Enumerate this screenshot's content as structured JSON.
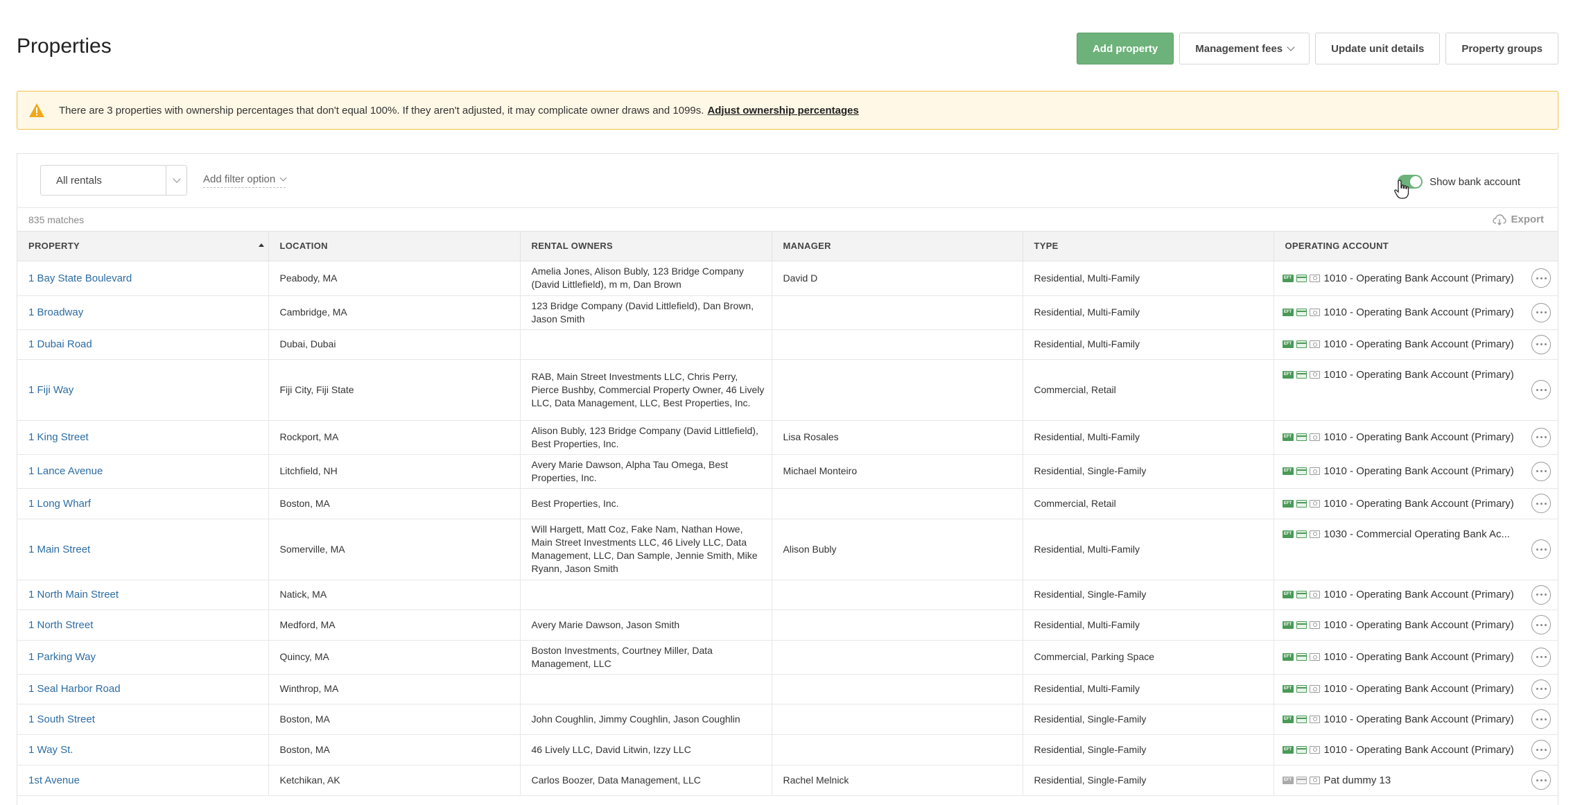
{
  "page": {
    "title": "Properties"
  },
  "toolbar": {
    "add_property": "Add property",
    "management_fees": "Management fees",
    "update_unit_details": "Update unit details",
    "property_groups": "Property groups"
  },
  "warning": {
    "message": "There are 3 properties with ownership percentages that don't equal 100%. If they aren't adjusted, it may complicate owner draws and 1099s.",
    "link": "Adjust ownership percentages"
  },
  "filters": {
    "rentals_select": "All rentals",
    "add_filter": "Add filter option",
    "show_bank_account": "Show bank account",
    "show_bank_account_on": true
  },
  "results": {
    "matches": "835 matches",
    "export": "Export"
  },
  "table": {
    "columns": [
      "PROPERTY",
      "LOCATION",
      "RENTAL OWNERS",
      "MANAGER",
      "TYPE",
      "OPERATING ACCOUNT"
    ],
    "rows": [
      {
        "property": "1 Bay State Boulevard",
        "location": "Peabody, MA",
        "owners": "Amelia Jones, Alison Bubly, 123 Bridge Company (David Littlefield), m m, Dan Brown",
        "manager": "David D",
        "type": "Residential, Multi-Family",
        "account": "1010 - Operating Bank Account (Primary)"
      },
      {
        "property": "1 Broadway",
        "location": "Cambridge, MA",
        "owners": "123 Bridge Company (David Littlefield), Dan Brown, Jason Smith",
        "manager": "",
        "type": "Residential, Multi-Family",
        "account": "1010 - Operating Bank Account (Primary)"
      },
      {
        "property": "1 Dubai Road",
        "location": "Dubai, Dubai",
        "owners": "",
        "manager": "",
        "type": "Residential, Multi-Family",
        "account": "1010 - Operating Bank Account (Primary)"
      },
      {
        "property": "1 Fiji Way",
        "location": "Fiji City, Fiji State",
        "owners": "RAB, Main Street Investments LLC, Chris Perry, Pierce Bushby, Commercial Property Owner, 46 Lively LLC, Data Management, LLC, Best Properties, Inc.",
        "manager": "",
        "type": "Commercial, Retail",
        "account": "1010 - Operating Bank Account (Primary)"
      },
      {
        "property": "1 King Street",
        "location": "Rockport, MA",
        "owners": "Alison Bubly, 123 Bridge Company (David Littlefield), Best Properties, Inc.",
        "manager": "Lisa Rosales",
        "type": "Residential, Multi-Family",
        "account": "1010 - Operating Bank Account (Primary)"
      },
      {
        "property": "1 Lance Avenue",
        "location": "Litchfield, NH",
        "owners": "Avery Marie Dawson, Alpha Tau Omega, Best Properties, Inc.",
        "manager": "Michael Monteiro",
        "type": "Residential, Single-Family",
        "account": "1010 - Operating Bank Account (Primary)"
      },
      {
        "property": "1 Long Wharf",
        "location": "Boston, MA",
        "owners": "Best Properties, Inc.",
        "manager": "",
        "type": "Commercial, Retail",
        "account": "1010 - Operating Bank Account (Primary)"
      },
      {
        "property": "1 Main Street",
        "location": "Somerville, MA",
        "owners": "Will Hargett, Matt Coz, Fake Nam, Nathan Howe, Main Street Investments LLC, 46 Lively LLC, Data Management, LLC, Dan Sample, Jennie Smith, Mike Ryann, Jason Smith",
        "manager": "Alison Bubly",
        "type": "Residential, Multi-Family",
        "account": "1030 - Commercial Operating Bank Ac..."
      },
      {
        "property": "1 North Main Street",
        "location": "Natick, MA",
        "owners": "",
        "manager": "",
        "type": "Residential, Single-Family",
        "account": "1010 - Operating Bank Account (Primary)"
      },
      {
        "property": "1 North Street",
        "location": "Medford, MA",
        "owners": "Avery Marie Dawson, Jason Smith",
        "manager": "",
        "type": "Residential, Multi-Family",
        "account": "1010 - Operating Bank Account (Primary)"
      },
      {
        "property": "1 Parking Way",
        "location": "Quincy, MA",
        "owners": "Boston Investments, Courtney Miller, Data Management, LLC",
        "manager": "",
        "type": "Commercial, Parking Space",
        "account": "1010 - Operating Bank Account (Primary)"
      },
      {
        "property": "1 Seal Harbor Road",
        "location": "Winthrop, MA",
        "owners": "",
        "manager": "",
        "type": "Residential, Multi-Family",
        "account": "1010 - Operating Bank Account (Primary)"
      },
      {
        "property": "1 South Street",
        "location": "Boston, MA",
        "owners": "John Coughlin, Jimmy Coughlin, Jason Coughlin",
        "manager": "",
        "type": "Residential, Single-Family",
        "account": "1010 - Operating Bank Account (Primary)"
      },
      {
        "property": "1 Way St.",
        "location": "Boston, MA",
        "owners": "46 Lively LLC, David Litwin, Izzy LLC",
        "manager": "",
        "type": "Residential, Single-Family",
        "account": "1010 - Operating Bank Account (Primary)"
      },
      {
        "property": "1st Avenue",
        "location": "Ketchikan, AK",
        "owners": "Carlos Boozer, Data Management, LLC",
        "manager": "Rachel Melnick",
        "type": "Residential, Single-Family",
        "account": "Pat dummy 13"
      }
    ]
  },
  "icons": {
    "eft_label": "EFT"
  },
  "colors": {
    "primary_green": "#6db27a",
    "link_blue": "#2d6ca2",
    "warning_bg": "#fff8e6",
    "warning_border": "#f0c24a"
  }
}
